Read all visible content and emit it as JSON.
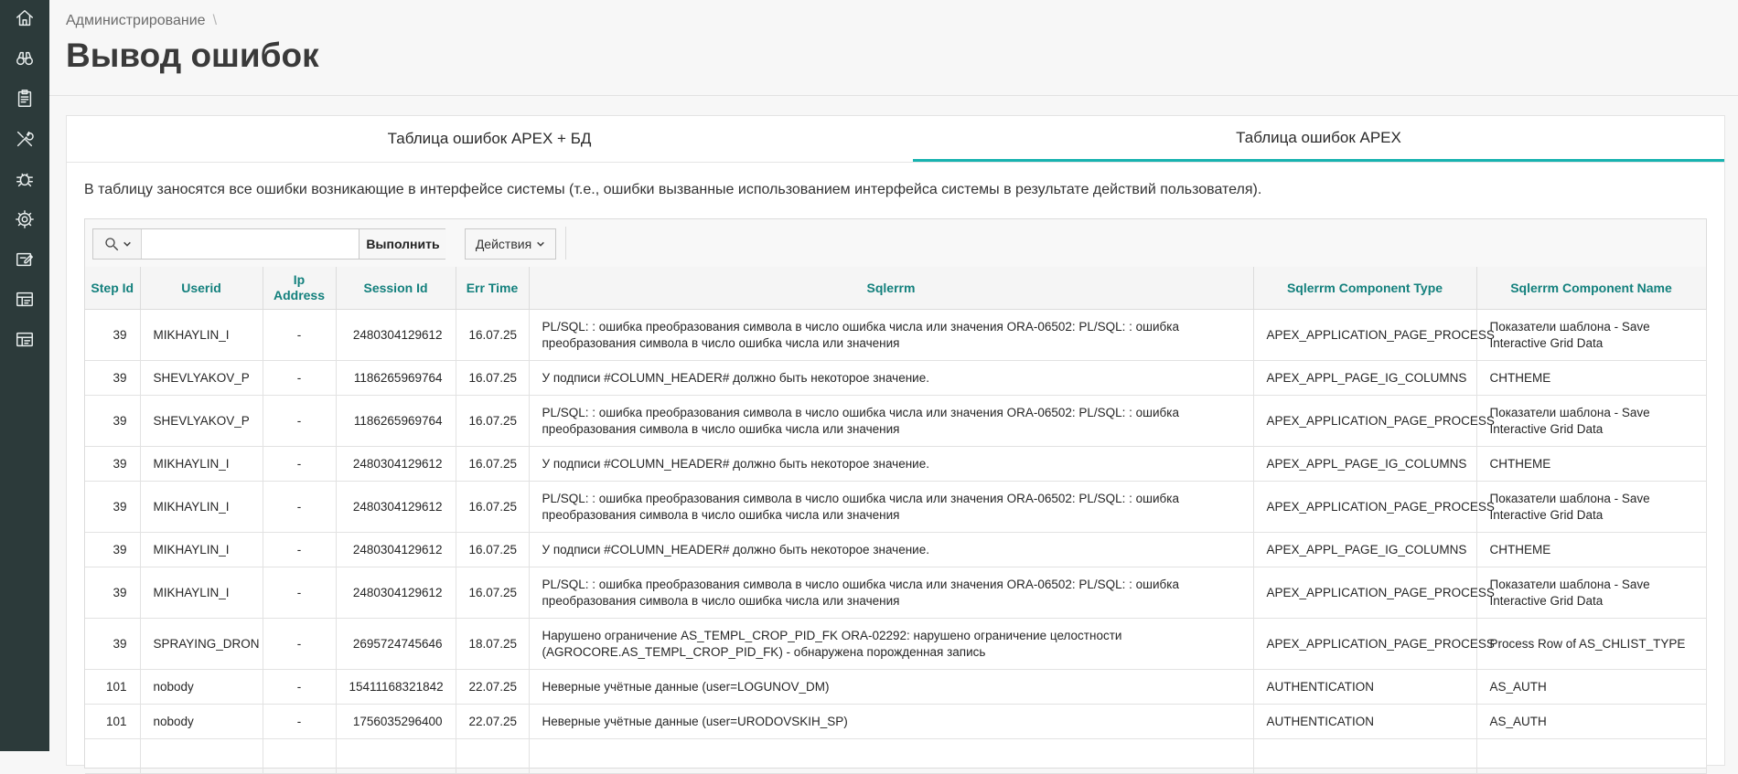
{
  "nav": {
    "items": [
      {
        "icon": "home-icon"
      },
      {
        "icon": "binoculars-icon"
      },
      {
        "icon": "clipboard-icon"
      },
      {
        "icon": "tools-icon"
      },
      {
        "icon": "bug-icon"
      },
      {
        "icon": "gear-icon"
      },
      {
        "icon": "form-edit-icon"
      },
      {
        "icon": "report-icon"
      },
      {
        "icon": "report-alt-icon"
      }
    ]
  },
  "header": {
    "breadcrumb": "Администрирование",
    "breadcrumb_sep": "\\",
    "title": "Вывод ошибок"
  },
  "tabs": [
    {
      "label": "Таблица ошибок APEX + БД",
      "active": false
    },
    {
      "label": "Таблица ошибок APEX",
      "active": true
    }
  ],
  "description": "В таблицу заносятся все ошибки возникающие в интерфейсе системы (т.е., ошибки вызванные использованием интерфейса системы в результате действий пользователя).",
  "toolbar": {
    "search_value": "",
    "go_label": "Выполнить",
    "actions_label": "Действия"
  },
  "table": {
    "headers": {
      "step_id": "Step Id",
      "userid": "Userid",
      "ip": "Ip Address",
      "session": "Session Id",
      "err_time": "Err Time",
      "sqlerrm": "Sqlerrm",
      "comp_type": "Sqlerrm Component Type",
      "comp_name": "Sqlerrm Component Name"
    },
    "rows": [
      {
        "step": "39",
        "user": "MIKHAYLIN_I",
        "ip": "-",
        "session": "2480304129612",
        "time": "16.07.25",
        "sqlerrm": "PL/SQL: : ошибка преобразования символа в число ошибка числа или значения ORA-06502: PL/SQL: : ошибка преобразования символа в число ошибка числа или значения",
        "type": "APEX_APPLICATION_PAGE_PROCESS",
        "name": "Показатели шаблона - Save Interactive Grid Data"
      },
      {
        "step": "39",
        "user": "SHEVLYAKOV_P",
        "ip": "-",
        "session": "1186265969764",
        "time": "16.07.25",
        "sqlerrm": "У подписи #COLUMN_HEADER# должно быть некоторое значение.",
        "type": "APEX_APPL_PAGE_IG_COLUMNS",
        "name": "CHTHEME"
      },
      {
        "step": "39",
        "user": "SHEVLYAKOV_P",
        "ip": "-",
        "session": "1186265969764",
        "time": "16.07.25",
        "sqlerrm": "PL/SQL: : ошибка преобразования символа в число ошибка числа или значения ORA-06502: PL/SQL: : ошибка преобразования символа в число ошибка числа или значения",
        "type": "APEX_APPLICATION_PAGE_PROCESS",
        "name": "Показатели шаблона - Save Interactive Grid Data"
      },
      {
        "step": "39",
        "user": "MIKHAYLIN_I",
        "ip": "-",
        "session": "2480304129612",
        "time": "16.07.25",
        "sqlerrm": "У подписи #COLUMN_HEADER# должно быть некоторое значение.",
        "type": "APEX_APPL_PAGE_IG_COLUMNS",
        "name": "CHTHEME"
      },
      {
        "step": "39",
        "user": "MIKHAYLIN_I",
        "ip": "-",
        "session": "2480304129612",
        "time": "16.07.25",
        "sqlerrm": "PL/SQL: : ошибка преобразования символа в число ошибка числа или значения ORA-06502: PL/SQL: : ошибка преобразования символа в число ошибка числа или значения",
        "type": "APEX_APPLICATION_PAGE_PROCESS",
        "name": "Показатели шаблона - Save Interactive Grid Data"
      },
      {
        "step": "39",
        "user": "MIKHAYLIN_I",
        "ip": "-",
        "session": "2480304129612",
        "time": "16.07.25",
        "sqlerrm": "У подписи #COLUMN_HEADER# должно быть некоторое значение.",
        "type": "APEX_APPL_PAGE_IG_COLUMNS",
        "name": "CHTHEME"
      },
      {
        "step": "39",
        "user": "MIKHAYLIN_I",
        "ip": "-",
        "session": "2480304129612",
        "time": "16.07.25",
        "sqlerrm": "PL/SQL: : ошибка преобразования символа в число ошибка числа или значения ORA-06502: PL/SQL: : ошибка преобразования символа в число ошибка числа или значения",
        "type": "APEX_APPLICATION_PAGE_PROCESS",
        "name": "Показатели шаблона - Save Interactive Grid Data"
      },
      {
        "step": "39",
        "user": "SPRAYING_DRON",
        "ip": "-",
        "session": "2695724745646",
        "time": "18.07.25",
        "sqlerrm": "Нарушено ограничение AS_TEMPL_CROP_PID_FK ORA-02292: нарушено ограничение целостности (AGROCORE.AS_TEMPL_CROP_PID_FK) - обнаружена порожденная запись",
        "type": "APEX_APPLICATION_PAGE_PROCESS",
        "name": "Process Row of AS_CHLIST_TYPE"
      },
      {
        "step": "101",
        "user": "nobody",
        "ip": "-",
        "session": "15411168321842",
        "time": "22.07.25",
        "sqlerrm": "Неверные учётные данные (user=LOGUNOV_DM)",
        "type": "AUTHENTICATION",
        "name": "AS_AUTH"
      },
      {
        "step": "101",
        "user": "nobody",
        "ip": "-",
        "session": "1756035296400",
        "time": "22.07.25",
        "sqlerrm": "Неверные учётные данные (user=URODOVSKIH_SP)",
        "type": "AUTHENTICATION",
        "name": "AS_AUTH"
      },
      {
        "step": "",
        "user": "",
        "ip": "",
        "session": "",
        "time": "",
        "sqlerrm": "",
        "type": "",
        "name": ""
      }
    ]
  },
  "colors": {
    "nav_bg": "#2c3a3a",
    "accent": "#17b3b0",
    "header_text": "#13807d"
  }
}
